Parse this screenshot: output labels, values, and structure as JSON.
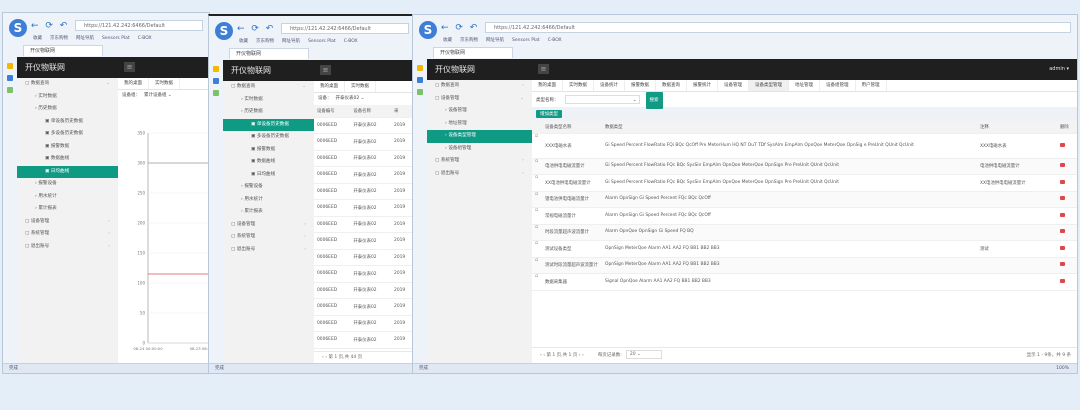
{
  "browser": {
    "url": "https://121.42.242:6466/Default",
    "nav_icons": "back-forward-refresh",
    "bookmarks": [
      "收藏",
      "京东购物",
      "网址导航",
      "Sensors Plat",
      "C-BOX"
    ],
    "tab_title": "开仪物联网",
    "status_text": "完成"
  },
  "app": {
    "title": "开仪物联网",
    "user": "admin ▾",
    "menu_icon": "≡"
  },
  "window1": {
    "sidebar": [
      {
        "label": "数据查询",
        "level": 0,
        "arrow": "⌄"
      },
      {
        "label": "实时数据",
        "level": 1
      },
      {
        "label": "历史数据",
        "level": 1
      },
      {
        "label": "单设备历史数据",
        "level": 2
      },
      {
        "label": "多设备历史数据",
        "level": 2
      },
      {
        "label": "报警数据",
        "level": 2
      },
      {
        "label": "数据曲线",
        "level": 2
      },
      {
        "label": "日均曲线",
        "level": 2,
        "active": true
      },
      {
        "label": "报警设备",
        "level": 1
      },
      {
        "label": "用水统计",
        "level": 1
      },
      {
        "label": "累计报表",
        "level": 1
      },
      {
        "label": "设备管理",
        "level": 0,
        "arrow": "›"
      },
      {
        "label": "系统管理",
        "level": 0,
        "arrow": "›"
      },
      {
        "label": "退出账号",
        "level": 0,
        "arrow": "›"
      }
    ],
    "tabs": [
      "我的桌面",
      "实时数据"
    ],
    "filter_label": "设备组：",
    "filter_value": "累计设备组",
    "chart_data": {
      "type": "line",
      "ylim": [
        0,
        350
      ],
      "yticks": [
        0,
        50,
        100,
        150,
        200,
        250,
        300,
        350
      ],
      "xticks": [
        "08-24 00:00:00",
        "08-23 06:2"
      ],
      "series": [
        {
          "color": "#999999",
          "values": [
            300,
            300,
            300
          ]
        },
        {
          "color": "#d9534f",
          "values": [
            115,
            115,
            115
          ]
        }
      ]
    }
  },
  "window2": {
    "sidebar": [
      {
        "label": "数据查询",
        "level": 0,
        "arrow": "⌄"
      },
      {
        "label": "实时数据",
        "level": 1
      },
      {
        "label": "历史数据",
        "level": 1
      },
      {
        "label": "单设备历史数据",
        "level": 2,
        "active": true
      },
      {
        "label": "多设备历史数据",
        "level": 2
      },
      {
        "label": "报警数据",
        "level": 2
      },
      {
        "label": "数据曲线",
        "level": 2
      },
      {
        "label": "日均曲线",
        "level": 2
      },
      {
        "label": "报警设备",
        "level": 1
      },
      {
        "label": "用水统计",
        "level": 1
      },
      {
        "label": "累计报表",
        "level": 1
      },
      {
        "label": "设备管理",
        "level": 0,
        "arrow": "›"
      },
      {
        "label": "系统管理",
        "level": 0,
        "arrow": "›"
      },
      {
        "label": "退出账号",
        "level": 0,
        "arrow": "›"
      }
    ],
    "tabs": [
      "我的桌面",
      "实时数据"
    ],
    "filter_label": "设备：",
    "filter_value": "开泰仪表02",
    "columns": [
      "设备编号",
      "设备名称",
      "采"
    ],
    "rows": [
      [
        "0006EED",
        "开泰仪表02",
        "2019"
      ],
      [
        "0006EED",
        "开泰仪表02",
        "2019"
      ],
      [
        "0006EED",
        "开泰仪表02",
        "2019"
      ],
      [
        "0006EED",
        "开泰仪表02",
        "2019"
      ],
      [
        "0006EED",
        "开泰仪表02",
        "2019"
      ],
      [
        "0006EED",
        "开泰仪表02",
        "2019"
      ],
      [
        "0006EED",
        "开泰仪表02",
        "2019"
      ],
      [
        "0006EED",
        "开泰仪表02",
        "2019"
      ],
      [
        "0006EED",
        "开泰仪表02",
        "2019"
      ],
      [
        "0006EED",
        "开泰仪表02",
        "2019"
      ],
      [
        "0006EED",
        "开泰仪表02",
        "2019"
      ],
      [
        "0006EED",
        "开泰仪表02",
        "2019"
      ],
      [
        "0006EED",
        "开泰仪表02",
        "2019"
      ],
      [
        "0006EED",
        "开泰仪表02",
        "2019"
      ]
    ],
    "pagination": "‹ ‹ 第 1 页,共 44 页"
  },
  "window3": {
    "sidebar": [
      {
        "label": "数据查询",
        "level": 0,
        "arrow": "›"
      },
      {
        "label": "设备管理",
        "level": 0,
        "arrow": "⌄"
      },
      {
        "label": "设备管理",
        "level": 1
      },
      {
        "label": "地址管理",
        "level": 1
      },
      {
        "label": "设备类型管理",
        "level": 1,
        "active": true
      },
      {
        "label": "设备组管理",
        "level": 1
      },
      {
        "label": "系统管理",
        "level": 0,
        "arrow": "›"
      },
      {
        "label": "退出账号",
        "level": 0,
        "arrow": "›"
      }
    ],
    "tabs": [
      {
        "label": "我的桌面"
      },
      {
        "label": "实时数据"
      },
      {
        "label": "设备统计"
      },
      {
        "label": "报警数据"
      },
      {
        "label": "数据查询"
      },
      {
        "label": "报警统计"
      },
      {
        "label": "设备管理"
      },
      {
        "label": "设备类型管理",
        "active": true
      },
      {
        "label": "地址管理"
      },
      {
        "label": "设备组管理"
      },
      {
        "label": "用户管理"
      }
    ],
    "search_label": "类型名称：",
    "search_value": "",
    "search_button": "搜索",
    "add_button": "增加类型",
    "columns": [
      "设备类型名称",
      "数据类型",
      "注释",
      "删除"
    ],
    "rows": [
      {
        "name": "XXX电磁水表",
        "types": "Gi Speed Percent FlowRatio FQi BQc QcOff Pre MeterHum HQ NT OuT TDf SysAlm EmpAlm OpnQoe MeterQoe OpnSig e PreUnit QUnit QcUnit",
        "note": "XXX电磁水表"
      },
      {
        "name": "电池供电电磁流量计",
        "types": "Gi Speed Percent FlowRatio FQc BQc SysSin EmpAlm OpnQoe MeterQoe OpnSign Pre PreUnit QUnit QcUnit",
        "note": "电池供电电磁流量计"
      },
      {
        "name": "XX电池供电电磁流量计",
        "types": "Gi Speed Percent FlowRatio FQc BQc SysSin EmpAlm OpnQoe MeterQoe OpnSign Pre PreUnit QUnit QcUnit",
        "note": "XX电池供电电磁流量计"
      },
      {
        "name": "锂电池供电电磁流量计",
        "types": "Alarm OpnSign Gi Speed Percent FQc BQc QcOff",
        "note": ""
      },
      {
        "name": "常规电磁流量计",
        "types": "Alarm OpnSign Gi Speed Percent FQc BQc QcOff",
        "note": ""
      },
      {
        "name": "时段流量超声波流量计",
        "types": "Alarm OpnQoe OpnSign Gi Speed FQ BQ",
        "note": ""
      },
      {
        "name": "测试设备类型",
        "types": "OpnSign MeterQoe Alarm AA1 AA2 FQ BB1 BB2 BB3",
        "note": "测试"
      },
      {
        "name": "测试时段流量超声波流量计",
        "types": "OpnSign MeterQoe Alarm AA1 AA2 FQ BB1 BB2 BB3",
        "note": ""
      },
      {
        "name": "数据采集器",
        "types": "Signal OpnQoe Alarm AA1 AA2 FQ BB1 BB2 BB3",
        "note": ""
      }
    ],
    "pagination": {
      "nav": "‹ ‹ 第 1 页,共 1 页 › ›",
      "per_page_label": "每页记录数:",
      "per_page": "20",
      "summary": "显示 1 - 9条，共 9 条"
    },
    "status_right": "100%"
  }
}
